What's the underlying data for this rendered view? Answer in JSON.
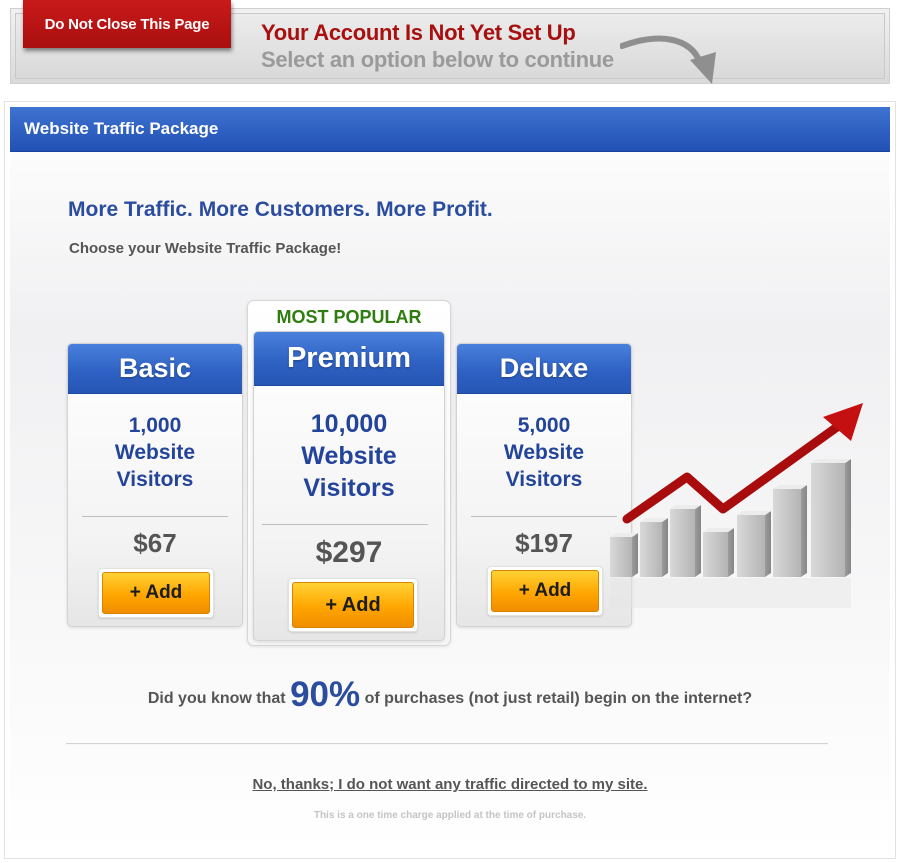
{
  "banner": {
    "warning_tab": "Do Not Close This Page",
    "title": "Your Account Is Not Yet Set Up",
    "subtitle": "Select an option below to continue"
  },
  "panel": {
    "header": "Website Traffic Package",
    "headline": "More Traffic. More Customers. More Profit.",
    "subheadline": "Choose your Website Traffic Package!"
  },
  "packages": [
    {
      "name": "Basic",
      "quantity": "1,000",
      "line1": "Website",
      "line2": "Visitors",
      "price": "$67",
      "button": "+ Add"
    },
    {
      "name": "Premium",
      "badge": "MOST POPULAR",
      "quantity": "10,000",
      "line1": "Website",
      "line2": "Visitors",
      "price": "$297",
      "button": "+ Add"
    },
    {
      "name": "Deluxe",
      "quantity": "5,000",
      "line1": "Website",
      "line2": "Visitors",
      "price": "$197",
      "button": "+ Add"
    }
  ],
  "fact": {
    "before": "Did you know that",
    "stat": "90%",
    "after": "of purchases (not just retail) begin on the internet?"
  },
  "decline_link": "No, thanks; I do not want any traffic directed to my site.",
  "footnote": "This is a one time charge applied at the time of purchase.",
  "colors": {
    "brand_blue": "#2b4d9f",
    "header_blue": "#2f62c4",
    "warning_red": "#a81010",
    "popular_green": "#2f7d0e",
    "button_orange": "#ffa600"
  }
}
